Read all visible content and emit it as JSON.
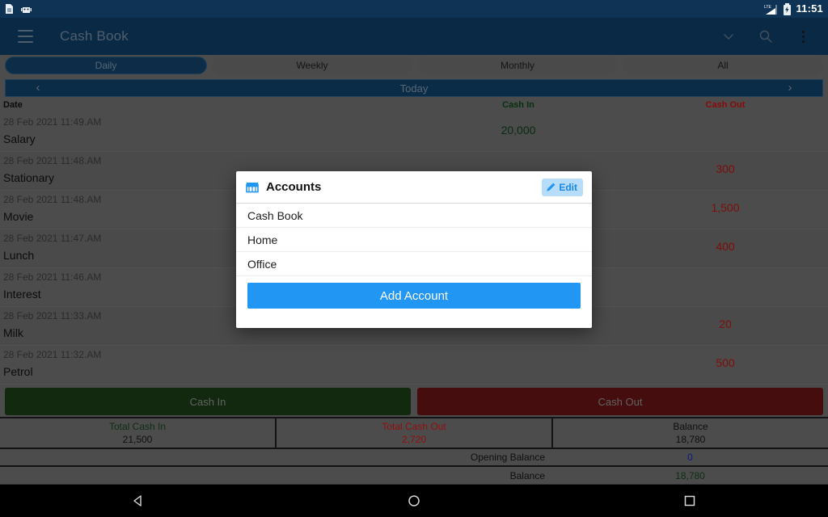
{
  "status_bar": {
    "time": "11:51",
    "left_icons": [
      "sim-card-icon",
      "android-robot-icon"
    ],
    "right_icons": [
      "lte-signal-icon",
      "battery-charging-icon"
    ]
  },
  "app_bar": {
    "menu_icon": "hamburger-menu-icon",
    "title": "Cash Book",
    "actions": [
      "chevron-down-icon",
      "search-icon",
      "overflow-menu-icon"
    ]
  },
  "tabs": [
    {
      "label": "Daily",
      "active": true
    },
    {
      "label": "Weekly",
      "active": false
    },
    {
      "label": "Monthly",
      "active": false
    },
    {
      "label": "All",
      "active": false
    }
  ],
  "date_nav": {
    "prev_icon": "chevron-left-icon",
    "label": "Today",
    "next_icon": "chevron-right-icon"
  },
  "list_header": {
    "date": "Date",
    "cash_in": "Cash In",
    "cash_out": "Cash Out"
  },
  "transactions": [
    {
      "date": "28 Feb 2021 11:49.AM",
      "desc": "Salary",
      "cash_in": "20,000",
      "cash_out": ""
    },
    {
      "date": "28 Feb 2021 11:48.AM",
      "desc": "Stationary",
      "cash_in": "",
      "cash_out": "300"
    },
    {
      "date": "28 Feb 2021 11:48.AM",
      "desc": "Movie",
      "cash_in": "",
      "cash_out": "1,500"
    },
    {
      "date": "28 Feb 2021 11:47.AM",
      "desc": "Lunch",
      "cash_in": "",
      "cash_out": "400"
    },
    {
      "date": "28 Feb 2021 11:46.AM",
      "desc": "Interest",
      "cash_in": "",
      "cash_out": ""
    },
    {
      "date": "28 Feb 2021 11:33.AM",
      "desc": "Milk",
      "cash_in": "",
      "cash_out": "20"
    },
    {
      "date": "28 Feb 2021 11:32.AM",
      "desc": "Petrol",
      "cash_in": "",
      "cash_out": "500"
    }
  ],
  "action_bar": {
    "cash_in_label": "Cash In",
    "cash_out_label": "Cash Out"
  },
  "summary": {
    "total_cash_in_label": "Total Cash In",
    "total_cash_in_value": "21,500",
    "total_cash_out_label": "Total Cash Out",
    "total_cash_out_value": "2,720",
    "balance_label": "Balance",
    "balance_value": "18,780",
    "opening_balance_label": "Opening Balance",
    "opening_balance_value": "0",
    "final_balance_label": "Balance",
    "final_balance_value": "18,780"
  },
  "dialog": {
    "icon": "storefront-icon",
    "title": "Accounts",
    "edit_label": "Edit",
    "edit_icon": "pencil-icon",
    "accounts": [
      {
        "name": "Cash Book"
      },
      {
        "name": "Home"
      },
      {
        "name": "Office"
      }
    ],
    "add_account_label": "Add Account"
  },
  "nav_bar": {
    "back_icon": "triangle-back-icon",
    "home_icon": "circle-home-icon",
    "recents_icon": "square-recents-icon"
  },
  "colors": {
    "appbar": "#0f3b63",
    "statusbar": "#0f3354",
    "accent_blue": "#2196f3",
    "cash_in_green": "#14421c",
    "cash_out_red": "#d01414",
    "page_bg": "#6e6e6e"
  }
}
